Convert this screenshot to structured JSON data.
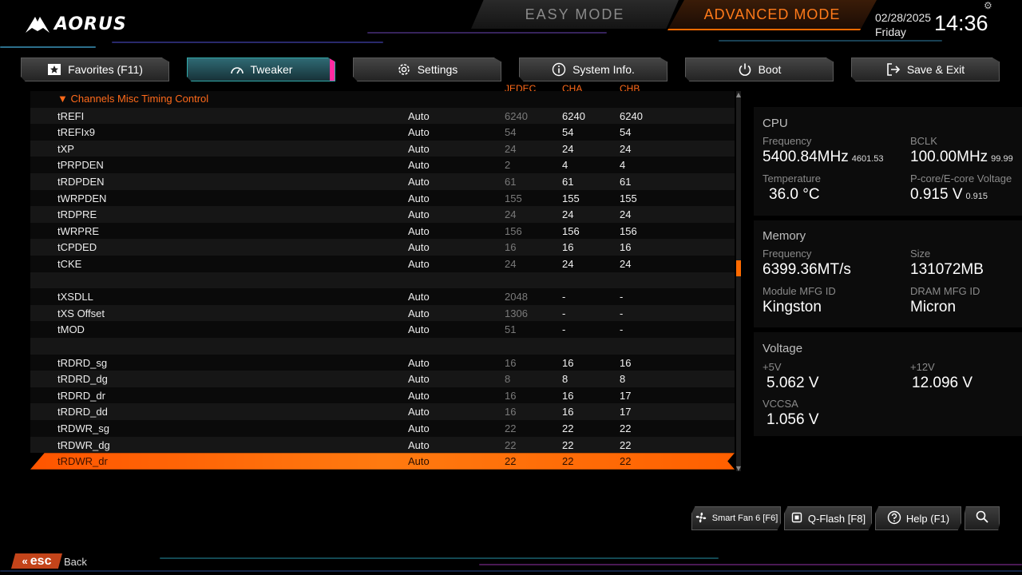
{
  "brand": "AORUS",
  "modes": {
    "easy": "EASY MODE",
    "advanced": "ADVANCED MODE"
  },
  "datetime": {
    "date": "02/28/2025",
    "day": "Friday",
    "time": "14:36"
  },
  "tabs": [
    {
      "label": "Favorites (F11)",
      "icon": "star-icon"
    },
    {
      "label": "Tweaker",
      "icon": "speedometer-icon"
    },
    {
      "label": "Settings",
      "icon": "gear-icon"
    },
    {
      "label": "System Info.",
      "icon": "info-icon"
    },
    {
      "label": "Boot",
      "icon": "power-icon"
    },
    {
      "label": "Save & Exit",
      "icon": "exit-icon"
    }
  ],
  "columns": {
    "jedec": "JEDEC",
    "cha": "CHA",
    "chb": "CHB"
  },
  "section_title": "Channels Misc Timing Control",
  "rows": [
    {
      "name": "tREFI",
      "value": "Auto",
      "jedec": "6240",
      "cha": "6240",
      "chb": "6240"
    },
    {
      "name": "tREFIx9",
      "value": "Auto",
      "jedec": "54",
      "cha": "54",
      "chb": "54"
    },
    {
      "name": "tXP",
      "value": "Auto",
      "jedec": "24",
      "cha": "24",
      "chb": "24"
    },
    {
      "name": "tPRPDEN",
      "value": "Auto",
      "jedec": "2",
      "cha": "4",
      "chb": "4"
    },
    {
      "name": "tRDPDEN",
      "value": "Auto",
      "jedec": "61",
      "cha": "61",
      "chb": "61"
    },
    {
      "name": "tWRPDEN",
      "value": "Auto",
      "jedec": "155",
      "cha": "155",
      "chb": "155"
    },
    {
      "name": "tRDPRE",
      "value": "Auto",
      "jedec": "24",
      "cha": "24",
      "chb": "24"
    },
    {
      "name": "tWRPRE",
      "value": "Auto",
      "jedec": "156",
      "cha": "156",
      "chb": "156"
    },
    {
      "name": "tCPDED",
      "value": "Auto",
      "jedec": "16",
      "cha": "16",
      "chb": "16"
    },
    {
      "name": "tCKE",
      "value": "Auto",
      "jedec": "24",
      "cha": "24",
      "chb": "24"
    },
    {
      "name": "",
      "value": "",
      "jedec": "",
      "cha": "",
      "chb": ""
    },
    {
      "name": "tXSDLL",
      "value": "Auto",
      "jedec": "2048",
      "cha": "-",
      "chb": "-"
    },
    {
      "name": "tXS Offset",
      "value": "Auto",
      "jedec": "1306",
      "cha": "-",
      "chb": "-"
    },
    {
      "name": "tMOD",
      "value": "Auto",
      "jedec": "51",
      "cha": "-",
      "chb": "-"
    },
    {
      "name": "",
      "value": "",
      "jedec": "",
      "cha": "",
      "chb": ""
    },
    {
      "name": "tRDRD_sg",
      "value": "Auto",
      "jedec": "16",
      "cha": "16",
      "chb": "16"
    },
    {
      "name": "tRDRD_dg",
      "value": "Auto",
      "jedec": "8",
      "cha": "8",
      "chb": "8"
    },
    {
      "name": "tRDRD_dr",
      "value": "Auto",
      "jedec": "16",
      "cha": "16",
      "chb": "17"
    },
    {
      "name": "tRDRD_dd",
      "value": "Auto",
      "jedec": "16",
      "cha": "16",
      "chb": "17"
    },
    {
      "name": "tRDWR_sg",
      "value": "Auto",
      "jedec": "22",
      "cha": "22",
      "chb": "22"
    },
    {
      "name": "tRDWR_dg",
      "value": "Auto",
      "jedec": "22",
      "cha": "22",
      "chb": "22"
    },
    {
      "name": "tRDWR_dr",
      "value": "Auto",
      "jedec": "22",
      "cha": "22",
      "chb": "22"
    }
  ],
  "selected_row": "tRDWR_dr",
  "cpu": {
    "title": "CPU",
    "freq_label": "Frequency",
    "freq": "5400.84MHz",
    "freq_sub": "4601.53",
    "bclk_label": "BCLK",
    "bclk": "100.00MHz",
    "bclk_sub": "99.99",
    "temp_label": "Temperature",
    "temp": "36.0 °C",
    "volt_label": "P-core/E-core Voltage",
    "volt": "0.915 V",
    "volt_sub": "0.915"
  },
  "memory": {
    "title": "Memory",
    "freq_label": "Frequency",
    "freq": "6399.36MT/s",
    "size_label": "Size",
    "size": "131072MB",
    "module_label": "Module MFG ID",
    "module": "Kingston",
    "dram_label": "DRAM MFG ID",
    "dram": "Micron"
  },
  "voltage": {
    "title": "Voltage",
    "v5_label": "+5V",
    "v5": "5.062 V",
    "v12_label": "+12V",
    "v12": "12.096 V",
    "vccsa_label": "VCCSA",
    "vccsa": "1.056 V"
  },
  "bottom": {
    "smartfan": "Smart Fan 6 [F6]",
    "qflash": "Q-Flash [F8]",
    "help": "Help (F1)",
    "esc": "esc",
    "back": "Back"
  },
  "colors": {
    "accent": "#ff6a00",
    "tweaker_tab": "#2f6a74",
    "pink": "#ff2aa0"
  }
}
